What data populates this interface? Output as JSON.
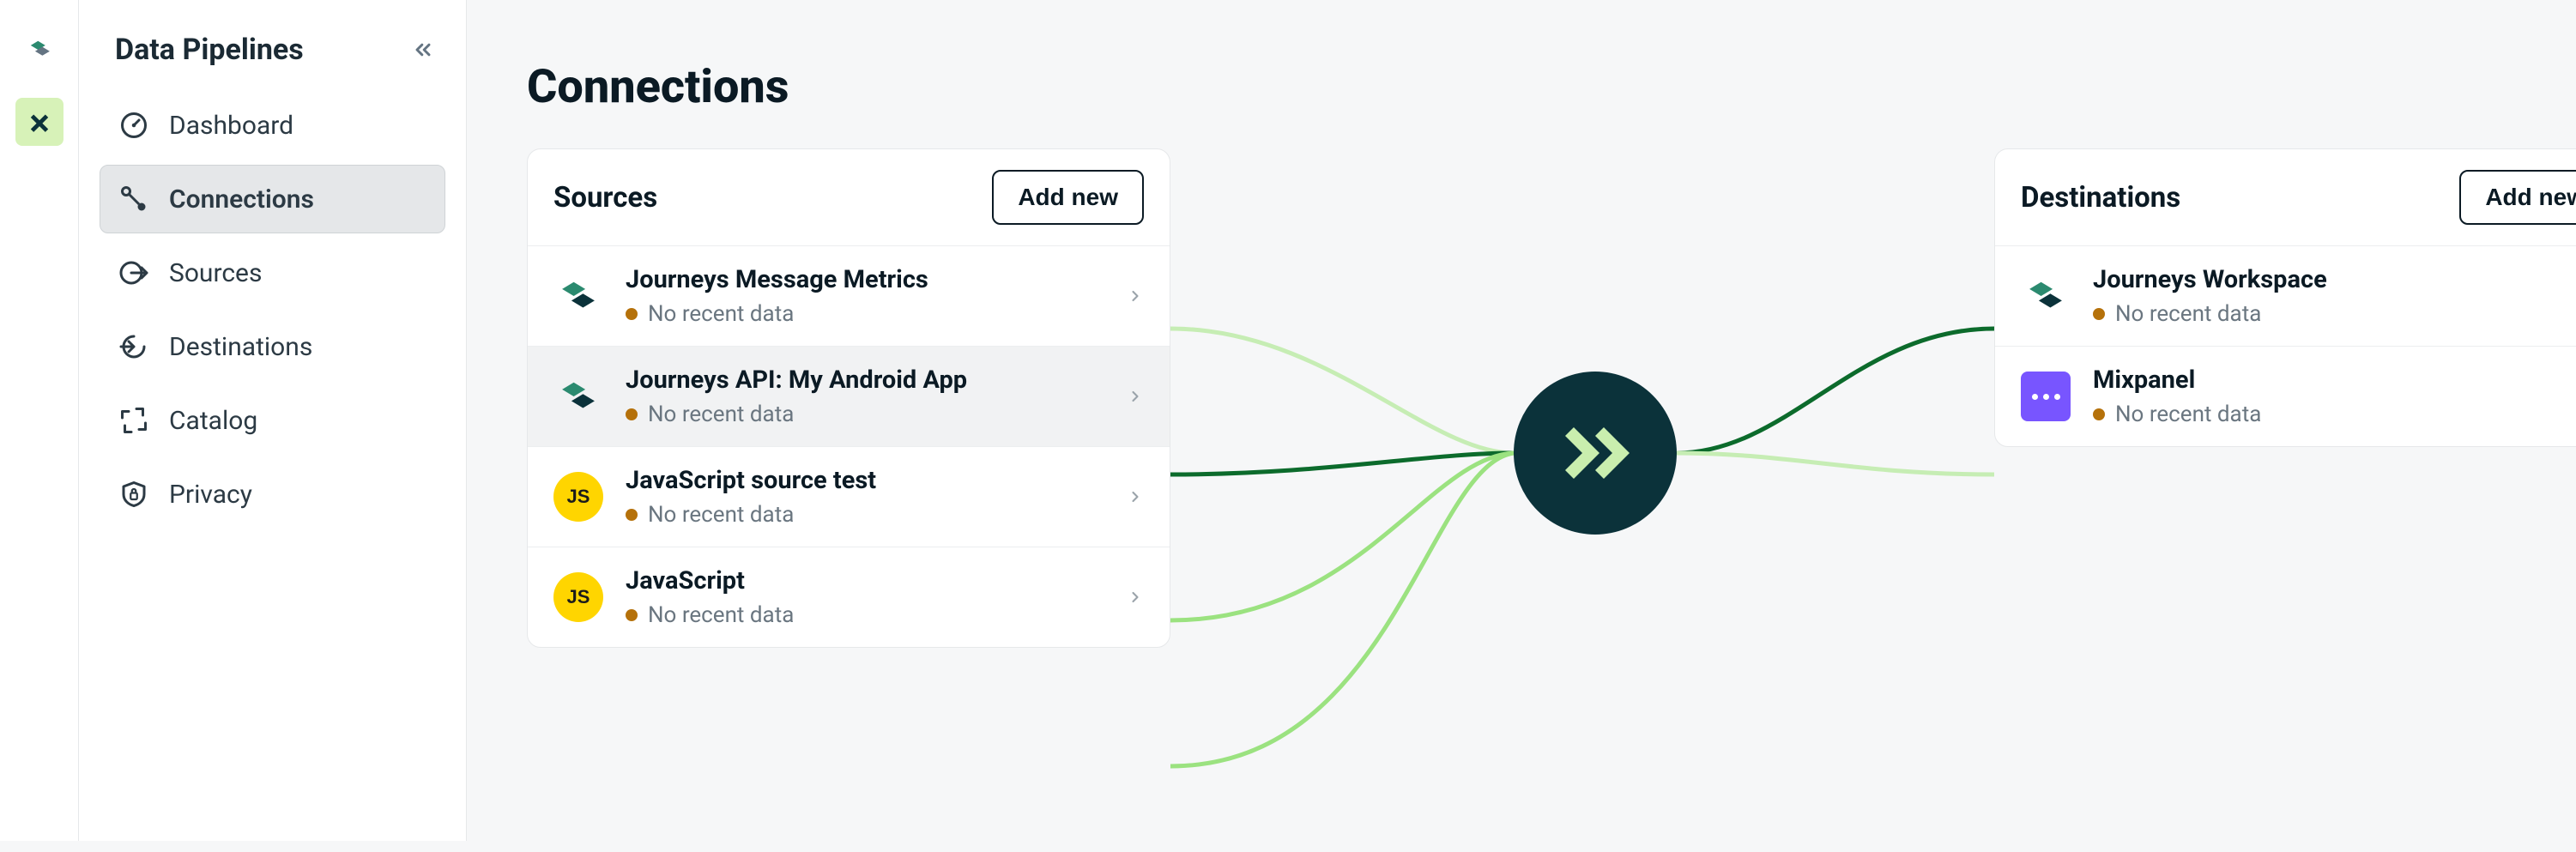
{
  "rail": {
    "items": [
      {
        "name": "app-switcher",
        "active": false
      },
      {
        "name": "workspace-x",
        "active": true
      }
    ]
  },
  "sidebar": {
    "title": "Data Pipelines",
    "items": [
      {
        "label": "Dashboard",
        "icon": "gauge-icon",
        "active": false
      },
      {
        "label": "Connections",
        "icon": "connections-icon",
        "active": true
      },
      {
        "label": "Sources",
        "icon": "sources-icon",
        "active": false
      },
      {
        "label": "Destinations",
        "icon": "destinations-icon",
        "active": false
      },
      {
        "label": "Catalog",
        "icon": "catalog-icon",
        "active": false
      },
      {
        "label": "Privacy",
        "icon": "privacy-icon",
        "active": false
      }
    ]
  },
  "page": {
    "title": "Connections"
  },
  "sources_panel": {
    "title": "Sources",
    "add_label": "Add new",
    "items": [
      {
        "title": "Journeys Message Metrics",
        "status": "No recent data",
        "icon": "journeys",
        "selected": false
      },
      {
        "title": "Journeys API: My Android App",
        "status": "No recent data",
        "icon": "journeys",
        "selected": true
      },
      {
        "title": "JavaScript source test",
        "status": "No recent data",
        "icon": "js",
        "selected": false
      },
      {
        "title": "JavaScript",
        "status": "No recent data",
        "icon": "js",
        "selected": false
      }
    ]
  },
  "destinations_panel": {
    "title": "Destinations",
    "add_label": "Add new",
    "items": [
      {
        "title": "Journeys Workspace",
        "status": "No recent data",
        "icon": "journeys",
        "selected": false
      },
      {
        "title": "Mixpanel",
        "status": "No recent data",
        "icon": "mixpanel",
        "selected": false
      }
    ]
  },
  "colors": {
    "wire_light": "#9be280",
    "wire_med": "#3bb54a",
    "wire_dark": "#0c6b2c",
    "wire_pale": "#c6edb4"
  }
}
